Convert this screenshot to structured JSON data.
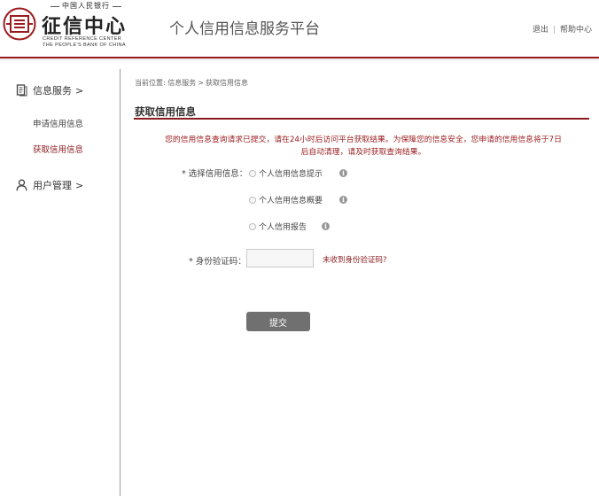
{
  "header": {
    "logo": {
      "top_text": "中国人民银行",
      "name_cn": "征信中心",
      "name_en_line1": "CREDIT REFERENCE CENTER",
      "name_en_line2": "THE PEOPLE'S BANK OF CHINA"
    },
    "platform_title": "个人信用信息服务平台",
    "links": {
      "logout": "退出",
      "separator": "|",
      "help": "帮助中心"
    }
  },
  "sidebar": {
    "credit_service": {
      "label": "信息服务",
      "chevron": ">",
      "icon": "document-icon",
      "items": [
        {
          "label": "申请信用信息",
          "active": false
        },
        {
          "label": "获取信用信息",
          "active": true
        }
      ]
    },
    "user_management": {
      "label": "用户管理",
      "chevron": ">",
      "icon": "user-icon"
    }
  },
  "main": {
    "breadcrumb": {
      "prefix": "当前位置:",
      "level1": "信息服务",
      "separator": ">",
      "level2": "获取信用信息"
    },
    "title": "获取信用信息",
    "notice_line1": "您的信用信息查询请求已提交，请在24小时后访问平台获取结果。为保障您的信息安全，您申请的信用信息将于7日",
    "notice_line2": "后自动清理，请及时获取查询结果。",
    "select_label": "* 选择信用信息：",
    "options": [
      {
        "label": "个人信用信息提示",
        "selected": false
      },
      {
        "label": "个人信用信息概要",
        "selected": false
      },
      {
        "label": "个人信用报告",
        "selected": false
      }
    ],
    "info_glyph": "i",
    "code_label": "* 身份验证码：",
    "code_value": "",
    "code_link": "未收到身份验证码?",
    "submit_label": "提交"
  },
  "colors": {
    "accent": "#9b1b1e",
    "active_menu": "#8a1c1f",
    "button": "#707070"
  }
}
